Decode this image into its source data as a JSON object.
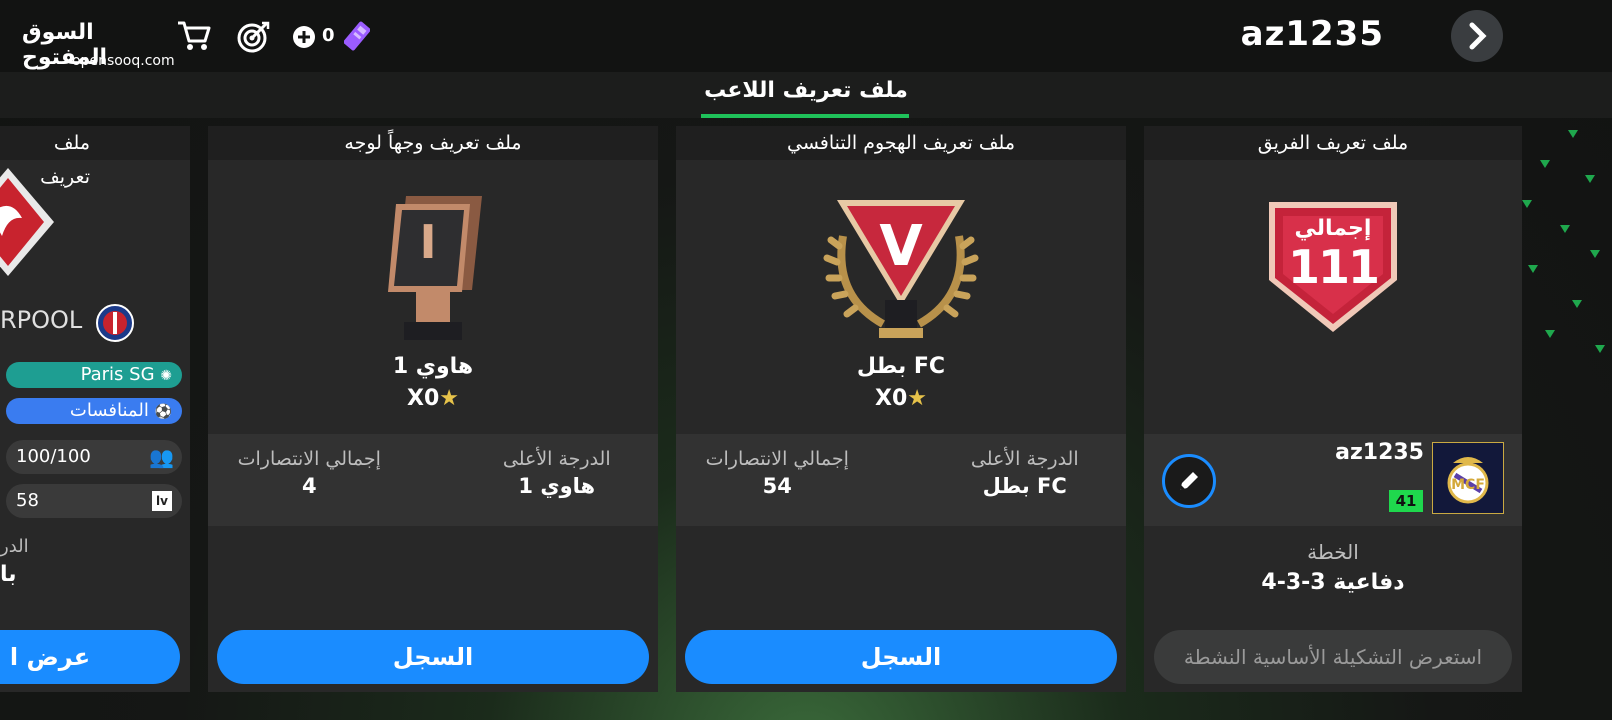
{
  "header": {
    "username": "az1235",
    "counter": "0"
  },
  "logo": {
    "arabic": "السوق المفتوح",
    "english": "opensooq.com"
  },
  "subheader": {
    "title": "ملف تعريف اللاعب"
  },
  "cards": {
    "team": {
      "title": "ملف تعريف الفريق",
      "badge_word": "إجمالي",
      "badge_number": "111",
      "club_name": "az1235",
      "level": "41",
      "formation_label": "الخطة",
      "formation_value": "4-3-3 دفاعية",
      "button": "استعرض التشكيلة الأساسية النشطة"
    },
    "rivals": {
      "title": "ملف تعريف الهجوم التنافسي",
      "rank_letter": "V",
      "rank_name": "بطل FC",
      "stars": "X0",
      "stat1_label": "الدرجة الأعلى",
      "stat1_value": "بطل FC",
      "stat2_label": "إجمالي الانتصارات",
      "stat2_value": "54",
      "button": "السجل"
    },
    "friendlies": {
      "title": "ملف تعريف وجهاً لوجه",
      "rank_name": "هاوي 1",
      "stars": "X0",
      "stat1_label": "الدرجة الأعلى",
      "stat1_value": "هاوي 1",
      "stat2_label": "إجمالي الانتصارات",
      "stat2_value": "4",
      "button": "السجل"
    },
    "partial": {
      "title": "ملف تعريف",
      "club": "RPOOL",
      "pill_team": "Paris SG",
      "pill_comp": "المنافسات",
      "members": "100/100",
      "level": "58",
      "label_cut": "الدر",
      "value_cut": "با",
      "button": "عرض ا"
    }
  },
  "colors": {
    "accent_green": "#1fc15a",
    "button_blue": "#1a8cff",
    "level_green": "#1fd84d"
  }
}
